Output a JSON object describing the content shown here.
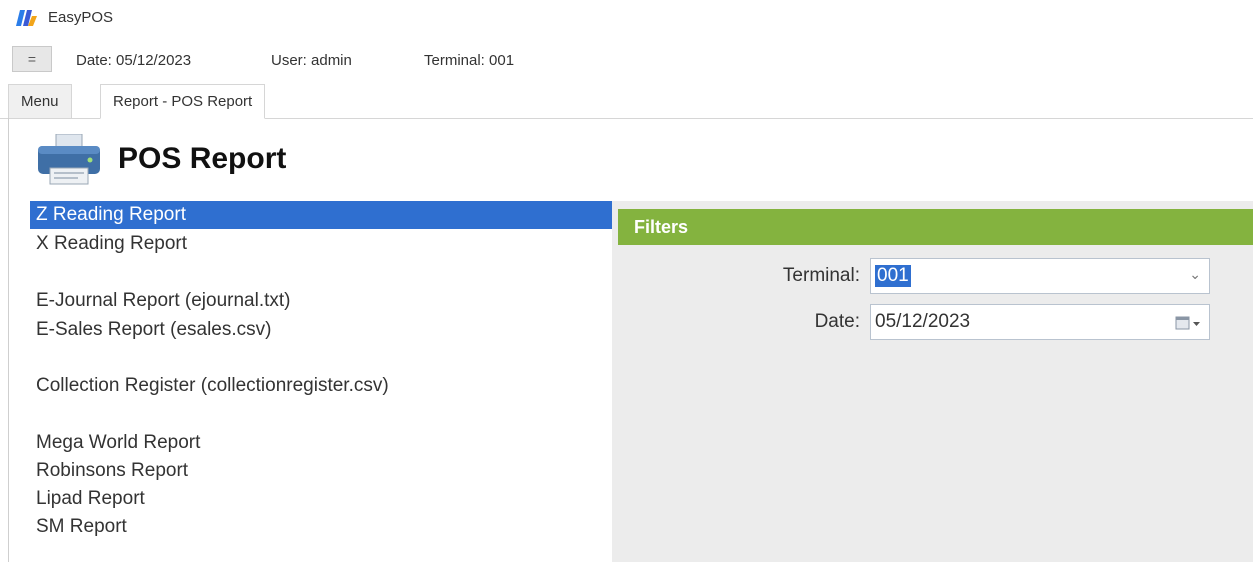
{
  "app": {
    "title": "EasyPOS"
  },
  "infobar": {
    "collapse_icon": "=",
    "date": "Date: 05/12/2023",
    "user": "User: admin",
    "terminal": "Terminal: 001"
  },
  "tabs": [
    {
      "label": "Menu",
      "active": false
    },
    {
      "label": "Report - POS Report",
      "active": true
    }
  ],
  "page": {
    "title": "POS Report",
    "icon": "printer-icon"
  },
  "reports": [
    {
      "label": "Z Reading Report",
      "selected": true
    },
    {
      "label": "X Reading Report",
      "selected": false
    },
    {
      "label": "E-Journal Report (ejournal.txt)",
      "selected": false
    },
    {
      "label": "E-Sales Report (esales.csv)",
      "selected": false
    },
    {
      "label": "Collection Register (collectionregister.csv)",
      "selected": false
    },
    {
      "label": "Mega World Report",
      "selected": false
    },
    {
      "label": "Robinsons Report",
      "selected": false
    },
    {
      "label": "Lipad Report",
      "selected": false
    },
    {
      "label": "SM Report",
      "selected": false
    }
  ],
  "filters": {
    "header": "Filters",
    "terminal_label": "Terminal:",
    "terminal_value": "001",
    "date_label": "Date:",
    "date_value": "05/12/2023"
  },
  "colors": {
    "selection": "#2f6fd0",
    "filters_header": "#84b33f",
    "panel_bg": "#ececec"
  }
}
